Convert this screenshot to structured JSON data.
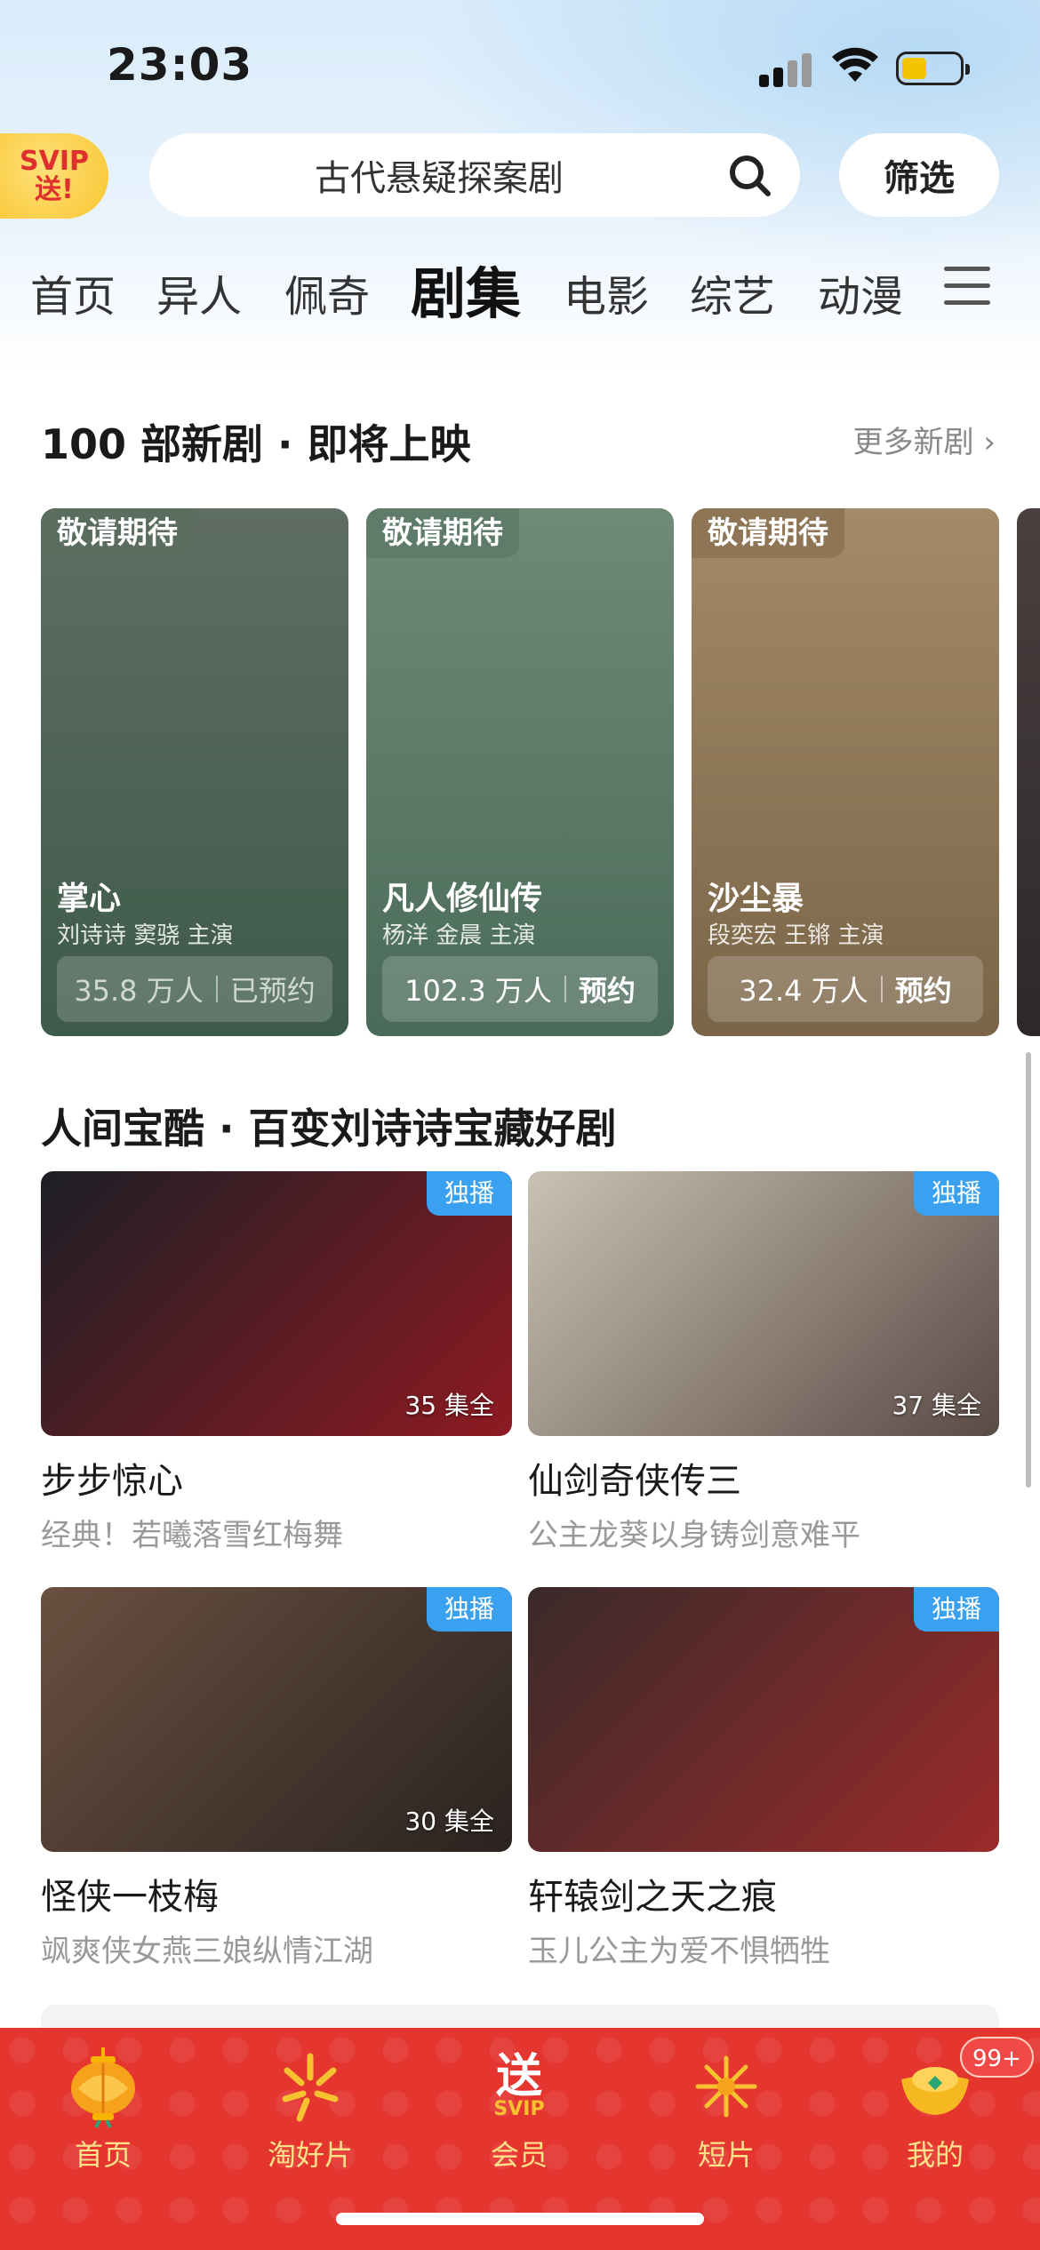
{
  "status_bar": {
    "time": "23:03"
  },
  "header": {
    "svip_badge": {
      "line1": "SVIP",
      "line2": "送!"
    },
    "search": {
      "text": "古代悬疑探案剧"
    },
    "filter_label": "筛选"
  },
  "tabs": [
    {
      "label": "首页"
    },
    {
      "label": "异人"
    },
    {
      "label": "佩奇"
    },
    {
      "label": "剧集",
      "active": true
    },
    {
      "label": "电影"
    },
    {
      "label": "综艺"
    },
    {
      "label": "动漫"
    }
  ],
  "upcoming": {
    "title": "100 部新剧 · 即将上映",
    "more": "更多新剧 ›",
    "cards": [
      {
        "tag": "敬请期待",
        "title": "掌心",
        "cast": "刘诗诗 窦骁 主演",
        "count": "35.8 万人",
        "action": "已预约",
        "colors": [
          "#5f6d62",
          "#3d5b4a"
        ]
      },
      {
        "tag": "敬请期待",
        "title": "凡人修仙传",
        "cast": "杨洋 金晨 主演",
        "count": "102.3 万人",
        "action": "预约",
        "colors": [
          "#6f8a76",
          "#4a6b5a"
        ]
      },
      {
        "tag": "敬请期待",
        "title": "沙尘暴",
        "cast": "段奕宏 王锵 主演",
        "count": "32.4 万人",
        "action": "预约",
        "colors": [
          "#a38a68",
          "#7a6548"
        ]
      }
    ]
  },
  "showcase": {
    "title": "人间宝酷 · 百变刘诗诗宝藏好剧",
    "items": [
      {
        "badge": "独播",
        "episodes": "35 集全",
        "name": "步步惊心",
        "desc": "经典！若曦落雪红梅舞",
        "colors": [
          "#1d1f26",
          "#8e1a22"
        ]
      },
      {
        "badge": "独播",
        "episodes": "37 集全",
        "name": "仙剑奇侠传三",
        "desc": "公主龙葵以身铸剑意难平",
        "colors": [
          "#c9c2b4",
          "#5a4a44"
        ]
      },
      {
        "badge": "独播",
        "episodes": "30 集全",
        "name": "怪侠一枝梅",
        "desc": "飒爽侠女燕三娘纵情江湖",
        "colors": [
          "#6a5040",
          "#2a2320"
        ]
      },
      {
        "badge": "独播",
        "episodes": "",
        "name": "轩辕剑之天之痕",
        "desc": "玉儿公主为爱不惧牺牲",
        "colors": [
          "#3a2a2a",
          "#9b2a2a"
        ]
      }
    ]
  },
  "bottom_nav": {
    "items": [
      {
        "label": "首页",
        "icon": "lantern-icon"
      },
      {
        "label": "淘好片",
        "icon": "firework-icon"
      },
      {
        "label": "会员",
        "icon": "svip-gift-icon",
        "glyph": "送",
        "sub": "SVIP"
      },
      {
        "label": "短片",
        "icon": "sparkle-icon"
      },
      {
        "label": "我的",
        "icon": "gold-ingot-icon"
      }
    ],
    "badge": "99+"
  }
}
